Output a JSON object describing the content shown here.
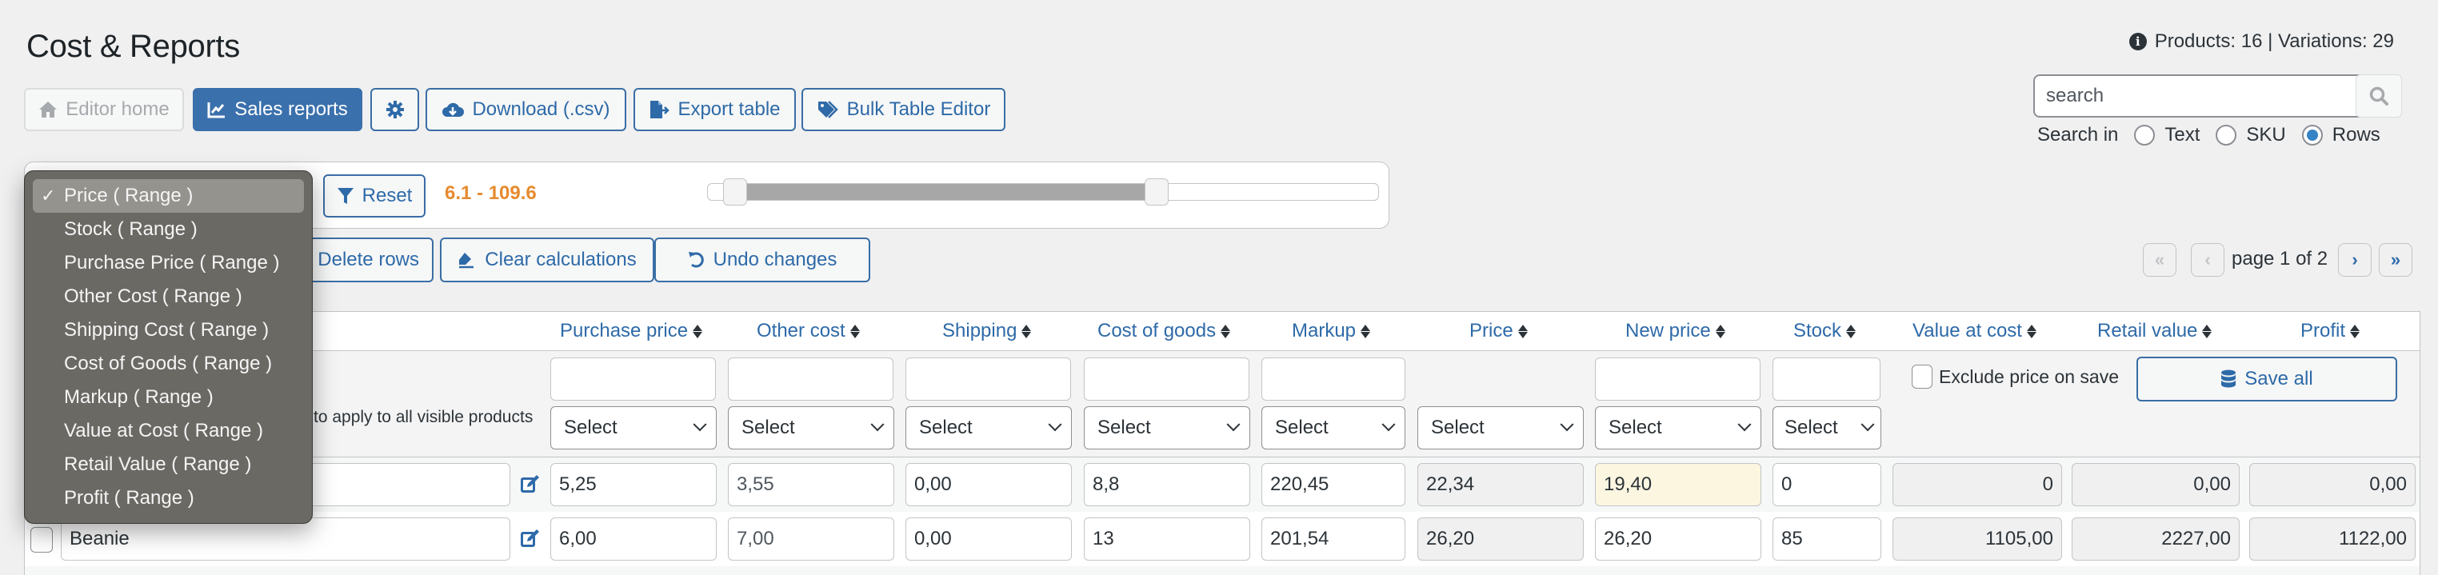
{
  "page": {
    "title": "Cost & Reports",
    "info": "Products: 16 | Variations: 29"
  },
  "toolbar": {
    "editor_home": "Editor home",
    "sales_reports": "Sales reports",
    "download_csv": "Download (.csv)",
    "export_table": "Export table",
    "bulk_table_editor": "Bulk Table Editor"
  },
  "search": {
    "placeholder": "search",
    "search_in_label": "Search in",
    "options": [
      {
        "label": "Text",
        "checked": false
      },
      {
        "label": "SKU",
        "checked": false
      },
      {
        "label": "Rows",
        "checked": true
      }
    ]
  },
  "filter": {
    "reset_label": "Reset",
    "range_text": "6.1 - 109.6",
    "slider": {
      "min_fraction": 0.04,
      "max_fraction": 0.67
    },
    "dropdown_options": [
      {
        "label": "Price ( Range )",
        "selected": true
      },
      {
        "label": "Stock ( Range )",
        "selected": false
      },
      {
        "label": "Purchase Price ( Range )",
        "selected": false
      },
      {
        "label": "Other Cost ( Range )",
        "selected": false
      },
      {
        "label": "Shipping Cost ( Range )",
        "selected": false
      },
      {
        "label": "Cost of Goods ( Range )",
        "selected": false
      },
      {
        "label": "Markup ( Range )",
        "selected": false
      },
      {
        "label": "Value at Cost ( Range )",
        "selected": false
      },
      {
        "label": "Retail Value ( Range )",
        "selected": false
      },
      {
        "label": "Profit ( Range )",
        "selected": false
      }
    ]
  },
  "actions": {
    "delete_rows": "Delete rows",
    "clear_calculations": "Clear calculations",
    "undo_changes": "Undo changes"
  },
  "pagination": {
    "label": "page 1 of 2",
    "first": "«",
    "prev": "‹",
    "next": "›",
    "last": "»"
  },
  "table": {
    "headers": [
      "Purchase price",
      "Other cost",
      "Shipping",
      "Cost of goods",
      "Markup",
      "Price",
      "New price",
      "Stock",
      "Value at cost",
      "Retail value",
      "Profit"
    ],
    "bulk": {
      "hint": "to apply to all visible products",
      "select_placeholder": "Select",
      "exclude_label": "Exclude price on save",
      "save_all": "Save all"
    },
    "rows": [
      {
        "name": "",
        "purchase_price": "5,25",
        "other_cost": "3,55",
        "shipping": "0,00",
        "cost_of_goods": "8,8",
        "markup": "220,45",
        "price": "22,34",
        "new_price": "19,40",
        "stock": "0",
        "value_at_cost": "0",
        "retail_value": "0,00",
        "profit": "0,00"
      },
      {
        "name": "Beanie",
        "purchase_price": "6,00",
        "other_cost": "7,00",
        "shipping": "0,00",
        "cost_of_goods": "13",
        "markup": "201,54",
        "price": "26,20",
        "new_price": "26,20",
        "stock": "85",
        "value_at_cost": "1105,00",
        "retail_value": "2227,00",
        "profit": "1122,00"
      }
    ]
  },
  "colors": {
    "accent": "#3a70ac",
    "range_text": "#e68a2e",
    "highlight_cell": "#fcf6e1"
  }
}
